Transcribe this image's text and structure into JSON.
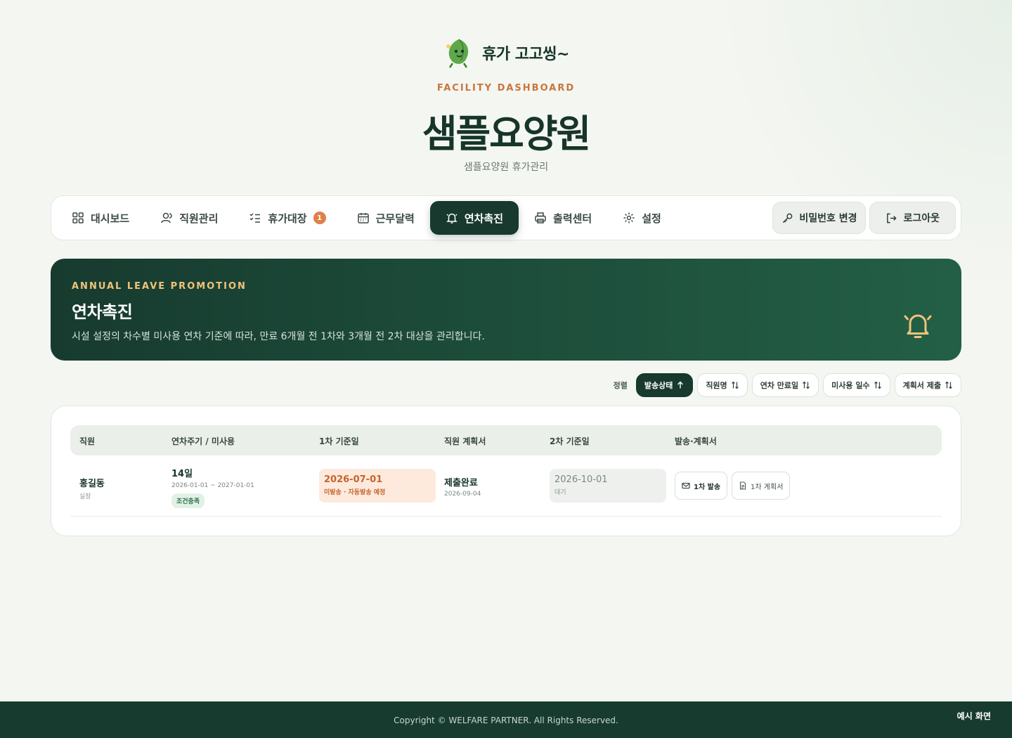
{
  "brand": {
    "name": "휴가 고고씽~",
    "mascot_icon": "leaf-mascot-icon"
  },
  "header": {
    "eyebrow": "FACILITY DASHBOARD",
    "title": "샘플요양원",
    "subtitle": "샘플요양원 휴가관리"
  },
  "nav": {
    "items": [
      {
        "label": "대시보드",
        "icon": "grid-icon"
      },
      {
        "label": "직원관리",
        "icon": "user-icon"
      },
      {
        "label": "휴가대장",
        "icon": "checklist-icon",
        "badge": "1"
      },
      {
        "label": "근무달력",
        "icon": "calendar-icon"
      },
      {
        "label": "연차촉진",
        "icon": "bell-icon",
        "active": true
      },
      {
        "label": "출력센터",
        "icon": "printer-icon"
      },
      {
        "label": "설정",
        "icon": "gear-icon"
      }
    ],
    "change_password": "비밀번호 변경",
    "logout": "로그아웃"
  },
  "hero": {
    "eyebrow": "ANNUAL LEAVE PROMOTION",
    "title": "연차촉진",
    "description": "시설 설정의 차수별 미사용 연차 기준에 따라, 만료 6개월 전 1차와 3개월 전 2차 대상을 관리합니다."
  },
  "sort": {
    "label": "정렬",
    "options": [
      {
        "label": "발송상태",
        "active": true
      },
      {
        "label": "직원명"
      },
      {
        "label": "연차 만료일"
      },
      {
        "label": "미사용 일수"
      },
      {
        "label": "계획서 제출"
      }
    ]
  },
  "table": {
    "columns": [
      "직원",
      "연차주기 / 미사용",
      "1차 기준일",
      "직원 계획서",
      "2차 기준일",
      "발송·계획서"
    ],
    "rows": [
      {
        "name": "홍길동",
        "role": "실장",
        "days": "14일",
        "cycle": "2026-01-01 ~ 2027-01-01",
        "tag": "조건충족",
        "first_date": "2026-07-01",
        "first_status": "미발송 · 자동발송 예정",
        "plan_status": "제출완료",
        "plan_date": "2026-09-04",
        "second_date": "2026-10-01",
        "second_status": "대기",
        "send_label": "1차 발송",
        "plan_label": "1차 계획서"
      }
    ]
  },
  "footer": {
    "copyright": "Copyright © WELFARE PARTNER. All Rights Reserved.",
    "demo": "예시 화면"
  },
  "colors": {
    "primary": "#17392e",
    "accent": "#c8763c",
    "badge": "#e07f4a",
    "gold": "#f0c37a"
  }
}
